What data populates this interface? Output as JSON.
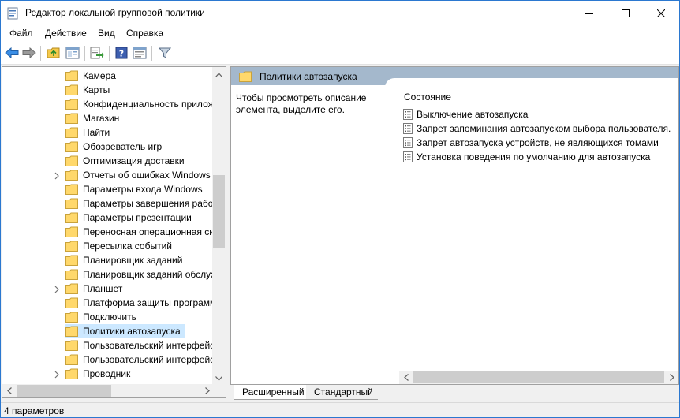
{
  "window": {
    "title": "Редактор локальной групповой политики",
    "controls": {
      "minimize": "minimize-icon",
      "maximize": "maximize-icon",
      "close": "close-icon"
    }
  },
  "menu": [
    {
      "id": "file",
      "label": "Файл"
    },
    {
      "id": "action",
      "label": "Действие"
    },
    {
      "id": "view",
      "label": "Вид"
    },
    {
      "id": "help",
      "label": "Справка"
    }
  ],
  "toolbar": {
    "icons": [
      "back-arrow-icon",
      "forward-arrow-icon",
      "up-folder-icon",
      "show-hide-tree-icon",
      "export-list-icon",
      "help-icon",
      "properties-icon",
      "filter-icon"
    ]
  },
  "tree": {
    "items": [
      {
        "label": "Камера",
        "expandable": false,
        "selected": false
      },
      {
        "label": "Карты",
        "expandable": false,
        "selected": false
      },
      {
        "label": "Конфиденциальность прилож",
        "expandable": false,
        "selected": false
      },
      {
        "label": "Магазин",
        "expandable": false,
        "selected": false
      },
      {
        "label": "Найти",
        "expandable": false,
        "selected": false
      },
      {
        "label": "Обозреватель игр",
        "expandable": false,
        "selected": false
      },
      {
        "label": "Оптимизация доставки",
        "expandable": false,
        "selected": false
      },
      {
        "label": "Отчеты об ошибках Windows",
        "expandable": true,
        "selected": false
      },
      {
        "label": "Параметры входа Windows",
        "expandable": false,
        "selected": false
      },
      {
        "label": "Параметры завершения работ",
        "expandable": false,
        "selected": false
      },
      {
        "label": "Параметры презентации",
        "expandable": false,
        "selected": false
      },
      {
        "label": "Переносная операционная си",
        "expandable": false,
        "selected": false
      },
      {
        "label": "Пересылка событий",
        "expandable": false,
        "selected": false
      },
      {
        "label": "Планировщик заданий",
        "expandable": false,
        "selected": false
      },
      {
        "label": "Планировщик заданий обслуж",
        "expandable": false,
        "selected": false
      },
      {
        "label": "Планшет",
        "expandable": true,
        "selected": false
      },
      {
        "label": "Платформа защиты программ",
        "expandable": false,
        "selected": false
      },
      {
        "label": "Подключить",
        "expandable": false,
        "selected": false
      },
      {
        "label": "Политики автозапуска",
        "expandable": false,
        "selected": true
      },
      {
        "label": "Пользовательский интерфейс",
        "expandable": false,
        "selected": false
      },
      {
        "label": "Пользовательский интерфейс",
        "expandable": false,
        "selected": false
      },
      {
        "label": "Проводник",
        "expandable": true,
        "selected": false
      }
    ]
  },
  "details": {
    "header_title": "Политики автозапуска",
    "description": "Чтобы просмотреть описание элемента, выделите его.",
    "column_header": "Состояние",
    "policies": [
      "Выключение автозапуска",
      "Запрет запоминания автозапуском выбора пользователя.",
      "Запрет автозапуска устройств, не являющихся томами",
      "Установка поведения по умолчанию для автозапуска"
    ]
  },
  "tabs": [
    {
      "label": "Расширенный",
      "active": true
    },
    {
      "label": "Стандартный",
      "active": false
    }
  ],
  "status": {
    "text": "4 параметров"
  },
  "colors": {
    "accent": "#2b78d0",
    "selection": "#cce8ff",
    "header_band": "#a4b8cc",
    "folder": "#ffd86b"
  }
}
